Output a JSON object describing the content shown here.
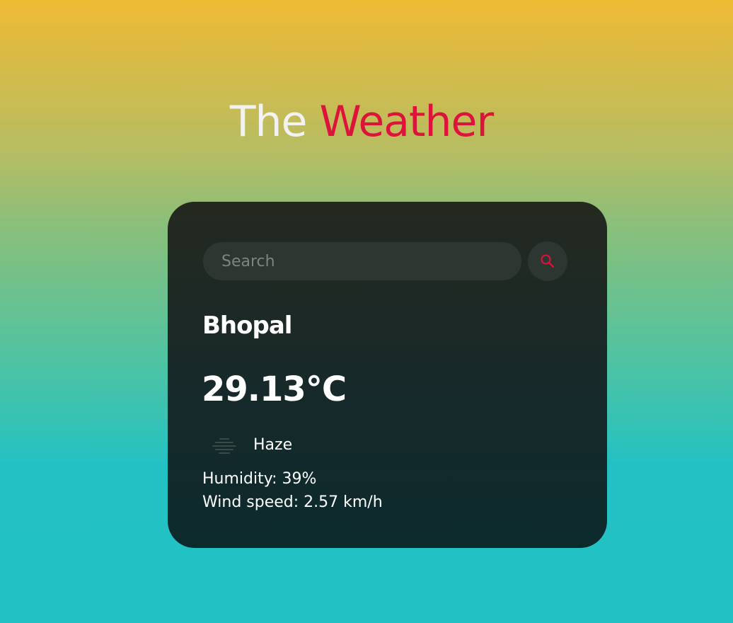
{
  "header": {
    "title_part1": "The",
    "title_part2": "Weather"
  },
  "search": {
    "placeholder": "Search",
    "value": "",
    "button_icon": "search-icon"
  },
  "weather": {
    "city": "Bhopal",
    "temperature": "29.13°C",
    "condition": "Haze",
    "condition_icon": "haze-icon",
    "humidity": "Humidity: 39%",
    "wind_speed": "Wind speed: 2.57 km/h"
  },
  "colors": {
    "accent": "#dc143c",
    "card_background": "#1c2a26",
    "gradient_top": "#efb934",
    "gradient_bottom": "#22c1c3"
  }
}
